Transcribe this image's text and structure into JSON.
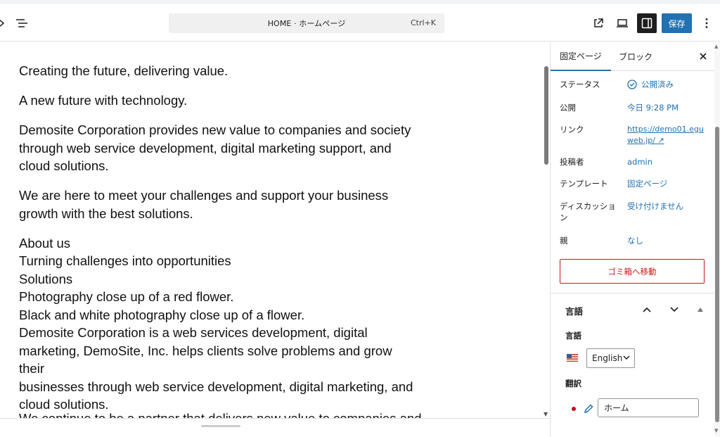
{
  "header": {
    "command_title": "HOME · ホームページ",
    "shortcut": "Ctrl+K",
    "save_label": "保存"
  },
  "content": {
    "paragraphs": [
      [
        "Creating the future, delivering value."
      ],
      [
        "A new future with technology."
      ],
      [
        "Demosite Corporation provides new value to companies and society",
        "through web service development, digital marketing support, and",
        "cloud solutions."
      ],
      [
        "We are here to meet your challenges and support your business",
        "growth with the best solutions."
      ],
      [
        "About us",
        "Turning challenges into opportunities",
        "Solutions",
        "Photography close up of a red flower.",
        "Black and white photography close up of a flower.",
        "Demosite Corporation is a web services development, digital",
        "marketing, DemoSite, Inc. helps clients solve problems and grow their",
        "businesses through web service development, digital marketing, and",
        "cloud solutions."
      ]
    ],
    "cut_line": "We continue to be a partner that delivers new value to companies and"
  },
  "sidebar": {
    "tabs": [
      "固定ページ",
      "ブロック"
    ],
    "rows": [
      {
        "label": "ステータス",
        "value": "公開済み"
      },
      {
        "label": "公開",
        "value": "今日 9:28 PM"
      },
      {
        "label": "リンク",
        "value": "https://demo01.eguweb.jp/ ↗"
      },
      {
        "label": "投稿者",
        "value": "admin"
      },
      {
        "label": "テンプレート",
        "value": "固定ページ"
      },
      {
        "label": "ディスカッション",
        "value": "受け付けません"
      },
      {
        "label": "親",
        "value": "なし"
      }
    ],
    "trash_label": "ゴミ箱へ移動",
    "language_panel": {
      "title": "言語",
      "language_label": "言語",
      "language_value": "English",
      "translation_label": "翻訳",
      "translation_value": "ホーム"
    }
  },
  "colors": {
    "accent": "#2271b1",
    "danger": "#cc1818",
    "dark": "#1e1e1e"
  }
}
